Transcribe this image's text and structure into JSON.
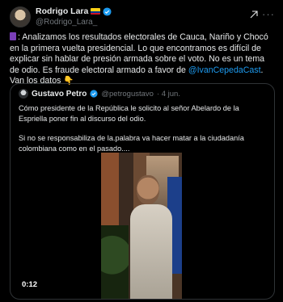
{
  "post": {
    "author_name": "Rodrigo Lara",
    "author_handle": "@Rodrigo_Lara_",
    "text_part1": ": Analizamos los resultados electorales de Cauca, Nariño y Chocó en la primera vuelta presidencial. Lo que encontramos es difícil de explicar sin hablar de presión armada sobre el voto. No es un tema de odio. Es fraude electoral armado a favor de ",
    "mention": "@IvanCepedaCast",
    "text_part2": ". Van los datos 👇"
  },
  "quote": {
    "author_name": "Gustavo Petro",
    "author_handle": "@petrogustavo",
    "date": "· 4 jun.",
    "paragraph1": "Cómo presidente de la República le solicito al señor Abelardo de la Espriella poner fin al discurso del odio.",
    "paragraph2": "Si no se responsabiliza de  la.palabra va hacer matar a la ciudadanía colombiana como en el pasado....",
    "video_time": "0:12"
  },
  "icons": {
    "verified_color": "#1d9bf0",
    "flag": "colombia-flag-icon",
    "more": "more-options-icon",
    "grok": "grok-icon"
  }
}
